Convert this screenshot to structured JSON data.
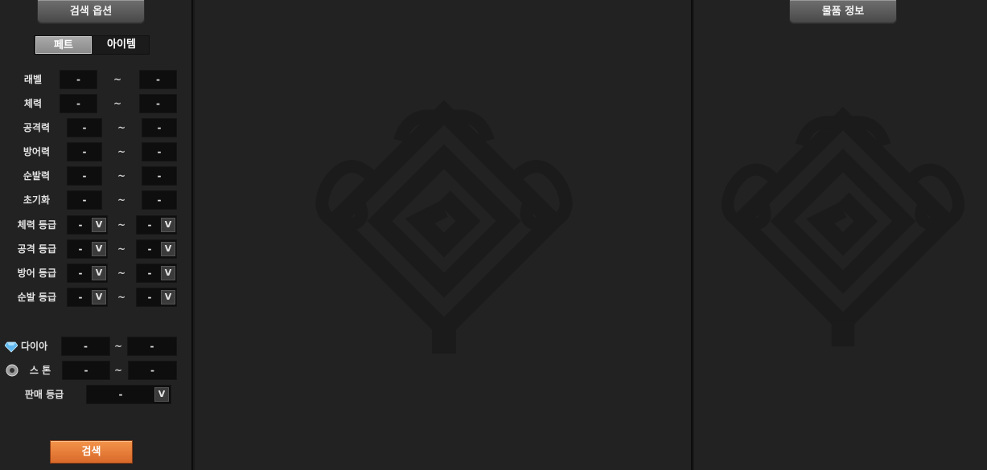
{
  "left_panel": {
    "header_label": "검색 옵션",
    "tabs": [
      "페트",
      "아이템"
    ],
    "ranges": [
      {
        "label": "래벨",
        "min": "-",
        "max": "-"
      },
      {
        "label": "체력",
        "min": "-",
        "max": "-"
      },
      {
        "label": "공격력",
        "min": "-",
        "max": "-"
      },
      {
        "label": "방어력",
        "min": "-",
        "max": "-"
      },
      {
        "label": "순발력",
        "min": "-",
        "max": "-"
      },
      {
        "label": "초기화",
        "min": "-",
        "max": "-"
      }
    ],
    "grades": [
      {
        "label": "체력 등급",
        "min": "-",
        "max": "-"
      },
      {
        "label": "공격 등급",
        "min": "-",
        "max": "-"
      },
      {
        "label": "방어 등급",
        "min": "-",
        "max": "-"
      },
      {
        "label": "순발 등급",
        "min": "-",
        "max": "-"
      }
    ],
    "currency": [
      {
        "label": "다이아",
        "icon": "diamond-icon",
        "min": "-",
        "max": "-"
      },
      {
        "label": "스 톤",
        "icon": "stone-icon",
        "min": "-",
        "max": "-"
      }
    ],
    "sale_grade": {
      "label": "판매 등급",
      "value": "-"
    },
    "separator": "~",
    "dropdown_glyph": "V",
    "search_label": "검색"
  },
  "right_panel": {
    "header_label": "물품 정보"
  },
  "colors": {
    "accent": "#e87a35",
    "panel": "#222222"
  }
}
